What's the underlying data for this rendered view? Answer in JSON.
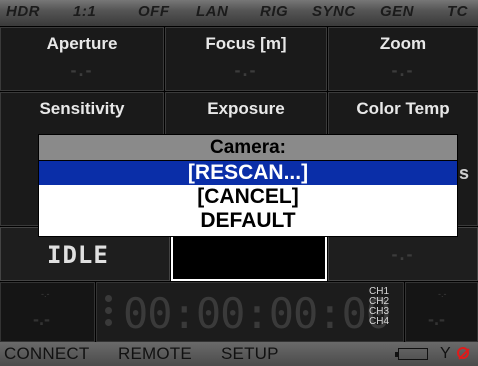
{
  "statusbar": {
    "items": [
      "HDR",
      "1:1",
      "OFF",
      "LAN",
      "RIG",
      "SYNC",
      "GEN",
      "TC"
    ]
  },
  "row1": {
    "cells": [
      {
        "label": "Aperture",
        "value": "-.-"
      },
      {
        "label": "Focus [m]",
        "value": "-.-"
      },
      {
        "label": "Zoom",
        "value": "-.-"
      }
    ]
  },
  "row2": {
    "cells": [
      {
        "label": "Sensitivity"
      },
      {
        "label": "Exposure"
      },
      {
        "label": "Color Temp"
      }
    ]
  },
  "partially_hidden_text": "s",
  "status_row": {
    "idle": "IDLE",
    "right_value": "-.-"
  },
  "timecode": {
    "left_small_top": "-.-",
    "left_dash": "-.-",
    "time": "00:00:00:00",
    "channels": [
      "CH1",
      "CH2",
      "CH3",
      "CH4"
    ],
    "right_small_top": "-.-",
    "right_dash": "-.-"
  },
  "bottom_nav": {
    "connect": "CONNECT",
    "remote": "REMOTE",
    "setup": "SETUP",
    "antenna_symbol": "Y"
  },
  "dialog": {
    "title": "Camera:",
    "options": [
      "[RESCAN...]",
      "[CANCEL]",
      "DEFAULT"
    ],
    "selected_index": 0,
    "colors": {
      "selected_bg": "#0a2ea8",
      "title_bg": "#8a8a8a"
    }
  },
  "colors": {
    "error_icon": "#e01b1b"
  }
}
